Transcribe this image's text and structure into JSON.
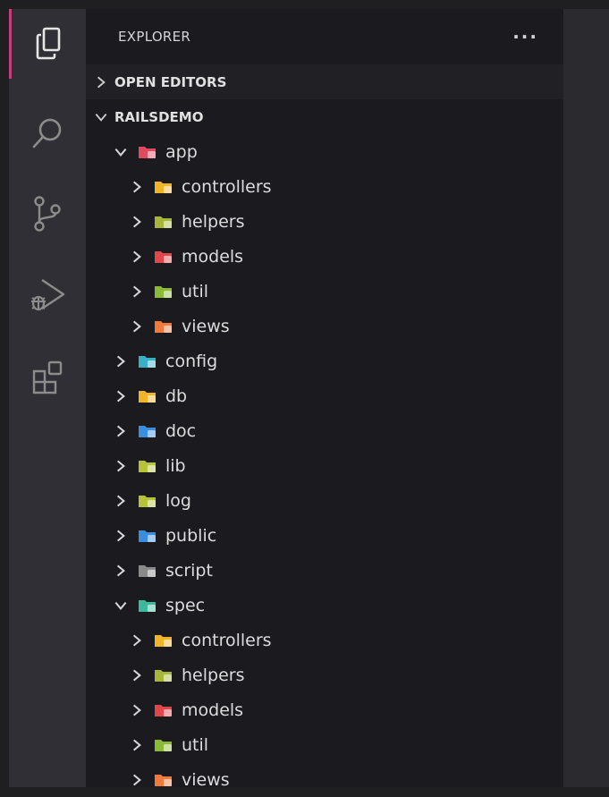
{
  "sidebar": {
    "title": "EXPLORER",
    "more": "···",
    "sections": {
      "open_editors": "OPEN EDITORS",
      "project": "RAILSDEMO"
    }
  },
  "activity_bar": [
    "explorer-icon",
    "search-icon",
    "source-control-icon",
    "run-debug-icon",
    "extensions-icon"
  ],
  "tree": [
    {
      "label": "app",
      "level": 1,
      "expanded": true,
      "color": "#e04a5f"
    },
    {
      "label": "controllers",
      "level": 2,
      "expanded": false,
      "color": "#f0b429"
    },
    {
      "label": "helpers",
      "level": 2,
      "expanded": false,
      "color": "#a7b63a"
    },
    {
      "label": "models",
      "level": 2,
      "expanded": false,
      "color": "#e0474c"
    },
    {
      "label": "util",
      "level": 2,
      "expanded": false,
      "color": "#8cba38"
    },
    {
      "label": "views",
      "level": 2,
      "expanded": false,
      "color": "#f07a3b"
    },
    {
      "label": "config",
      "level": 1,
      "expanded": false,
      "color": "#3ab0c8"
    },
    {
      "label": "db",
      "level": 1,
      "expanded": false,
      "color": "#f0b429"
    },
    {
      "label": "doc",
      "level": 1,
      "expanded": false,
      "color": "#3a8ee0"
    },
    {
      "label": "lib",
      "level": 1,
      "expanded": false,
      "color": "#b6c23a"
    },
    {
      "label": "log",
      "level": 1,
      "expanded": false,
      "color": "#b6c23a"
    },
    {
      "label": "public",
      "level": 1,
      "expanded": false,
      "color": "#3a8ee0"
    },
    {
      "label": "script",
      "level": 1,
      "expanded": false,
      "color": "#8a8a8a"
    },
    {
      "label": "spec",
      "level": 1,
      "expanded": true,
      "color": "#3cb89c"
    },
    {
      "label": "controllers",
      "level": 2,
      "expanded": false,
      "color": "#f0b429"
    },
    {
      "label": "helpers",
      "level": 2,
      "expanded": false,
      "color": "#a7b63a"
    },
    {
      "label": "models",
      "level": 2,
      "expanded": false,
      "color": "#e0474c"
    },
    {
      "label": "util",
      "level": 2,
      "expanded": false,
      "color": "#8cba38"
    },
    {
      "label": "views",
      "level": 2,
      "expanded": false,
      "color": "#f07a3b"
    }
  ]
}
